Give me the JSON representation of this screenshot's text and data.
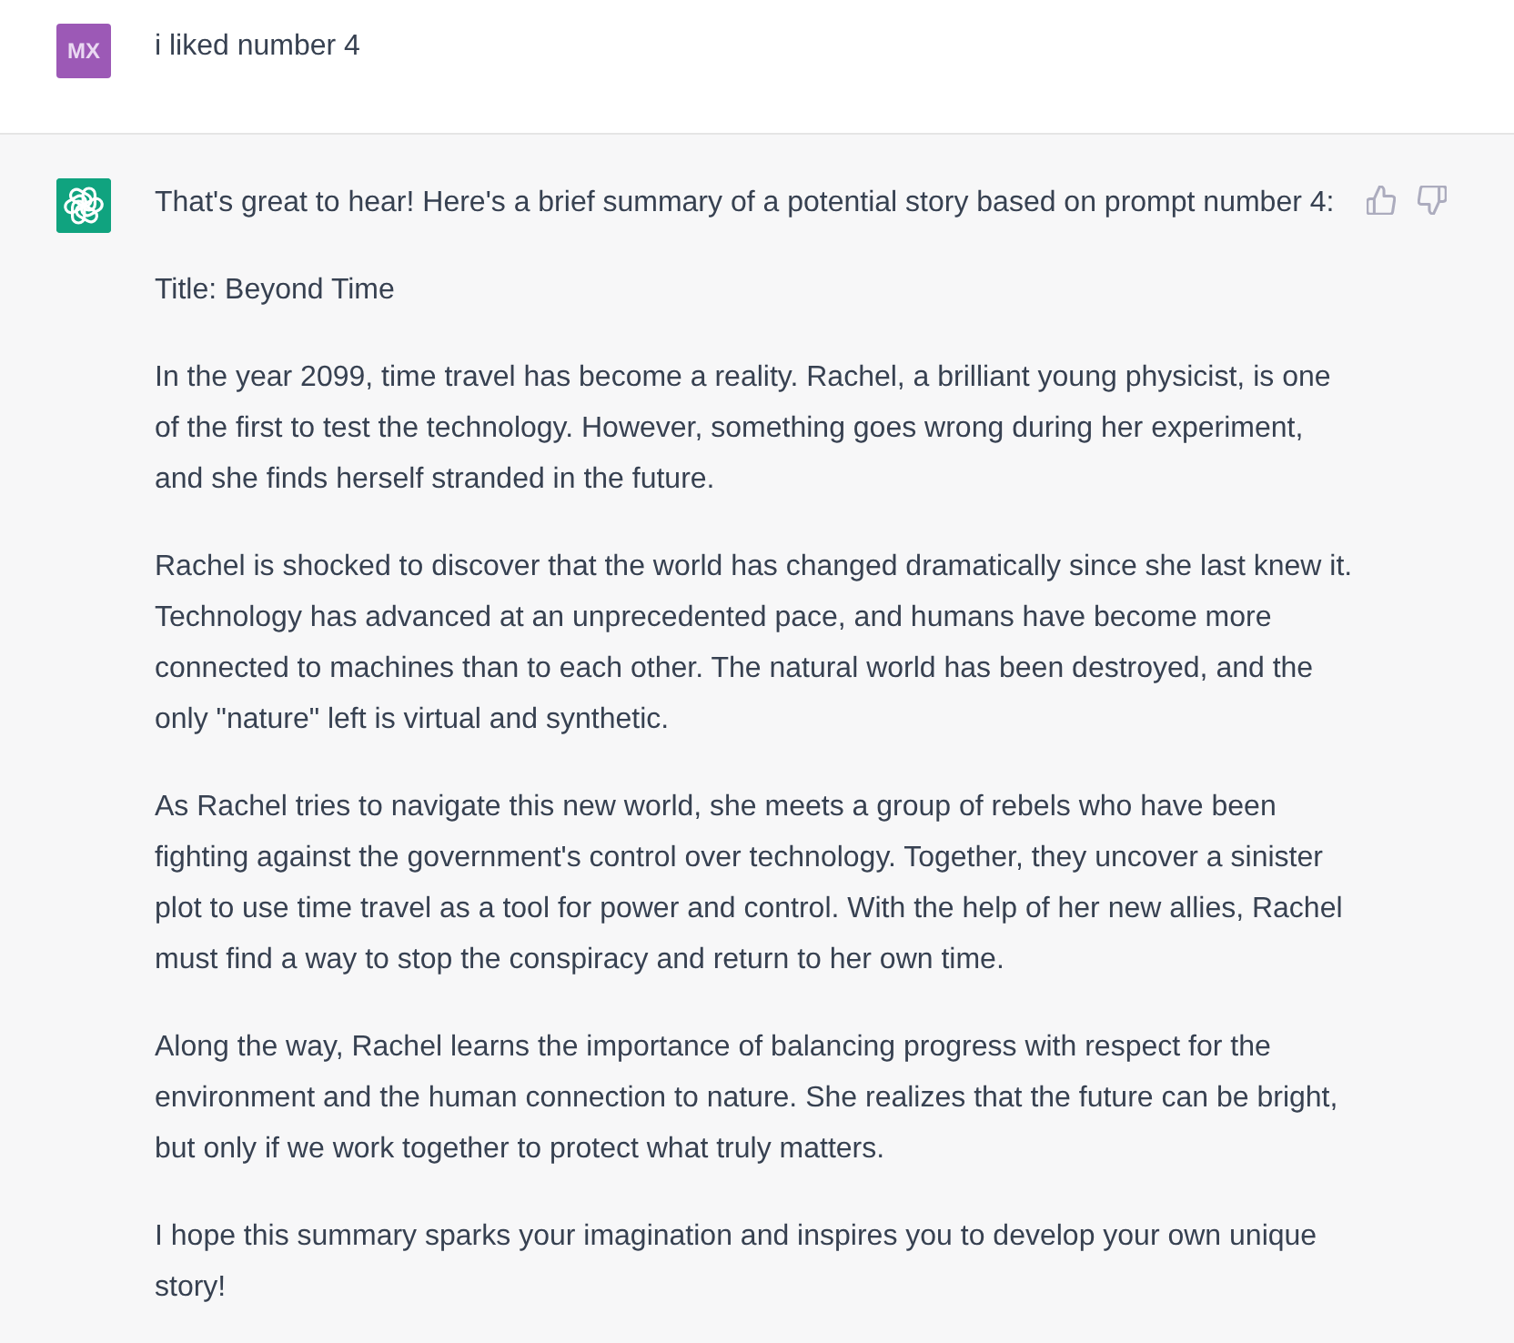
{
  "conversation": [
    {
      "kind": "user",
      "avatar": "MX",
      "paragraphs": [
        "i liked number 4"
      ]
    },
    {
      "kind": "assistant",
      "paragraphs": [
        "That's great to hear! Here's a brief summary of a potential story based on prompt number 4:",
        "Title: Beyond Time",
        "In the year 2099, time travel has become a reality. Rachel, a brilliant young physicist, is one of the first to test the technology. However, something goes wrong during her experiment, and she finds herself stranded in the future.",
        "Rachel is shocked to discover that the world has changed dramatically since she last knew it. Technology has advanced at an unprecedented pace, and humans have become more connected to machines than to each other. The natural world has been destroyed, and the only \"nature\" left is virtual and synthetic.",
        "As Rachel tries to navigate this new world, she meets a group of rebels who have been fighting against the government's control over technology. Together, they uncover a sinister plot to use time travel as a tool for power and control. With the help of her new allies, Rachel must find a way to stop the conspiracy and return to her own time.",
        "Along the way, Rachel learns the importance of balancing progress with respect for the environment and the human connection to nature. She realizes that the future can be bright, but only if we work together to protect what truly matters.",
        "I hope this summary sparks your imagination and inspires you to develop your own unique story!"
      ]
    }
  ]
}
